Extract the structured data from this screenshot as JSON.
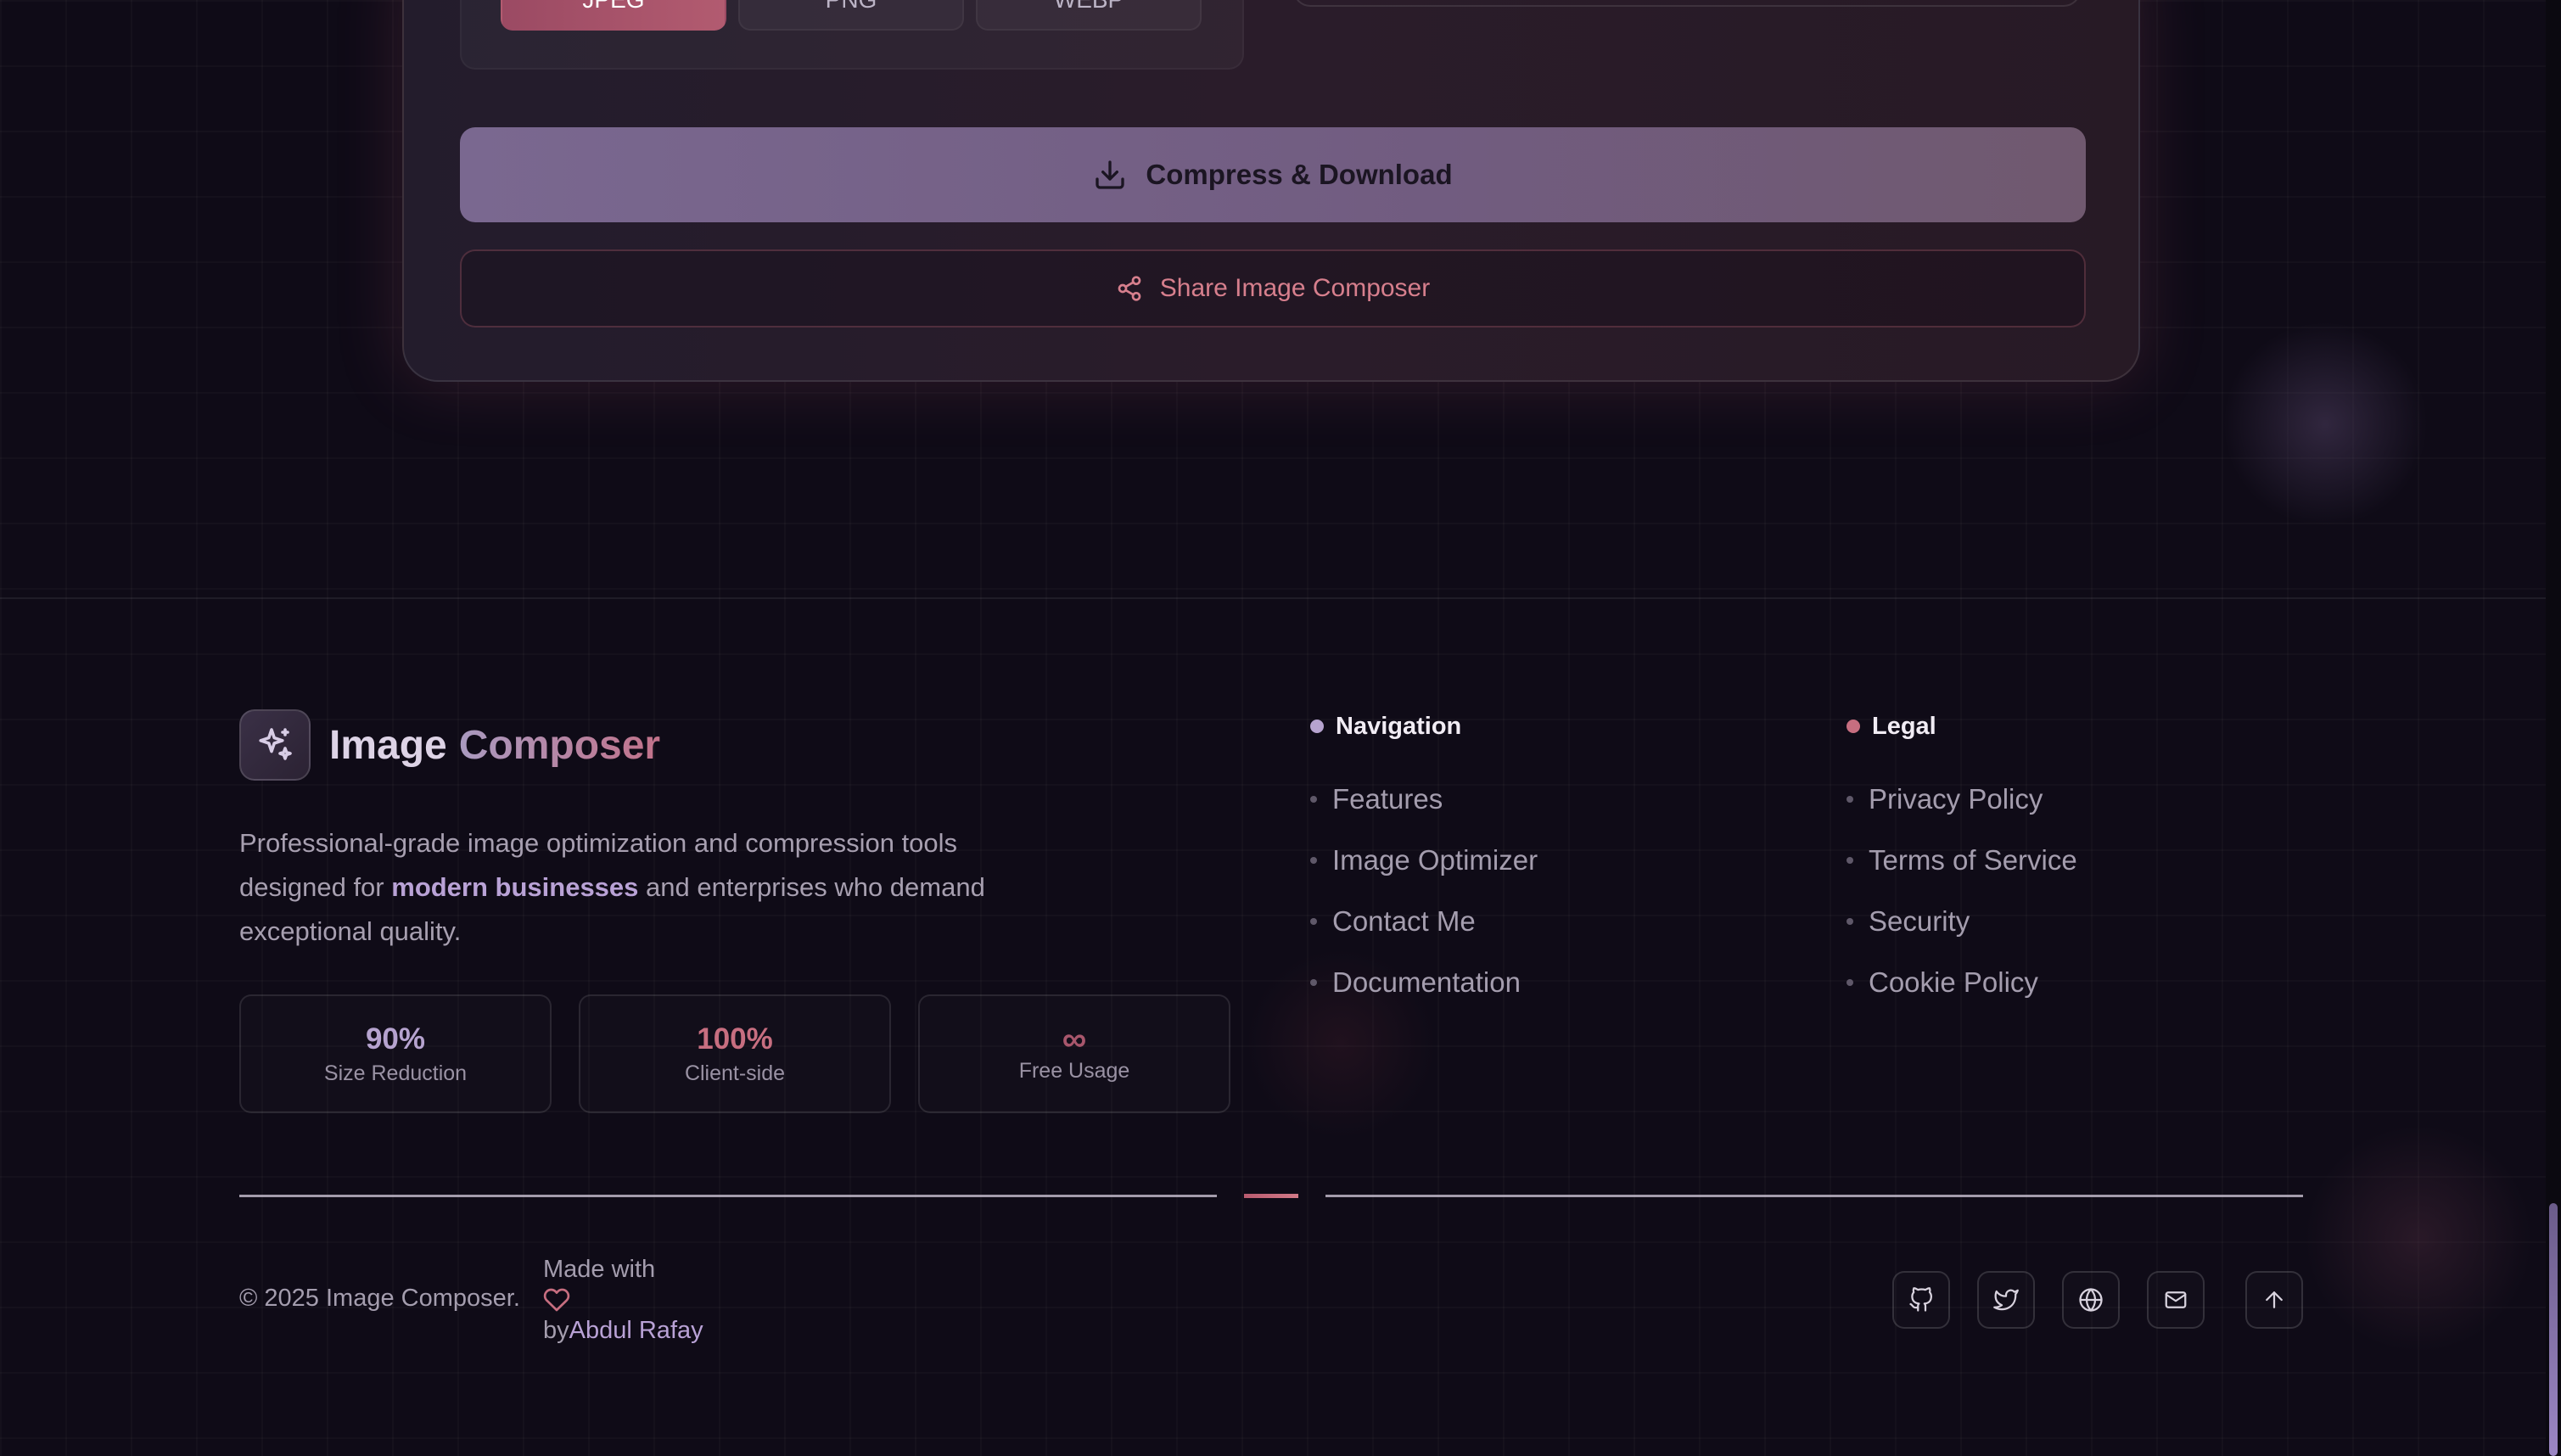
{
  "format_options": [
    {
      "label": "JPEG",
      "active": true
    },
    {
      "label": "PNG",
      "active": false
    },
    {
      "label": "WEBP",
      "active": false
    }
  ],
  "actions": {
    "compress_label": "Compress & Download",
    "share_label": "Share Image Composer"
  },
  "brand": {
    "name_part1": "Image",
    "name_part2": "Composer"
  },
  "tagline": {
    "before": "Professional-grade image optimization and compression tools designed for",
    "highlight": "modern businesses",
    "after": "and enterprises who demand exceptional quality."
  },
  "stats": [
    {
      "value": "90%",
      "label": "Size Reduction"
    },
    {
      "value": "100%",
      "label": "Client-side"
    },
    {
      "value": "∞",
      "label": "Free Usage"
    }
  ],
  "navigation": {
    "heading": "Navigation",
    "links": [
      "Features",
      "Image Optimizer",
      "Contact Me",
      "Documentation"
    ]
  },
  "legal": {
    "heading": "Legal",
    "links": [
      "Privacy Policy",
      "Terms of Service",
      "Security",
      "Cookie Policy"
    ]
  },
  "footer": {
    "copyright": "© 2025 Image Composer.",
    "made_with": "Made with",
    "by": "by",
    "author": "Abdul Rafay"
  },
  "social_icons": [
    "github-icon",
    "twitter-icon",
    "globe-icon",
    "mail-icon",
    "arrow-up-icon"
  ],
  "colors": {
    "background": "#0f0b17",
    "accent_purple": "#b6a3cf",
    "accent_pink": "#c76e80",
    "primary_button": "#7a6890"
  }
}
